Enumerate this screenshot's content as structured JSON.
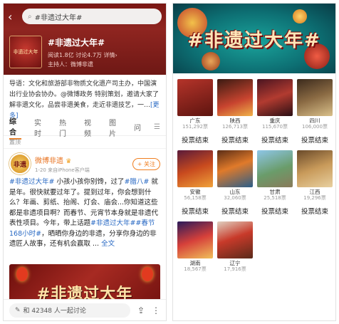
{
  "left": {
    "search_text": "#非遗过大年#",
    "topic": {
      "thumb_text": "非遗过大年",
      "title": "#非遗过大年#",
      "stats": "阅读1.8亿 讨论4.7万 详情›",
      "host": "主持人：微博非遗"
    },
    "guide": {
      "text": "导语：文化和旅游部非物质文化遗产司主办，中国演出行业协会协办。@微博政务 特别策划，邀请大家了解非遗文化，品尝非遗美食，走近非遗技艺，一…",
      "more": "[更多]"
    },
    "tabs": [
      "综合",
      "实时",
      "热门",
      "视频",
      "图片",
      "问"
    ],
    "pinned_label": "置顶",
    "post": {
      "avatar_text": "非遗",
      "author": "微博非遗",
      "time": "1-20 来自iPhone客户端",
      "follow": "+ 关注",
      "text_parts": [
        {
          "t": "#非遗过大年#",
          "tag": true
        },
        {
          "t": " 小孩小孩你别馋，过了",
          "tag": false
        },
        {
          "t": "#腊八#",
          "tag": true
        },
        {
          "t": " 就是年。很快就要过年了。提到过年，你会想到什么？年画、剪纸、抬阁、灯会、庙会...你知道这些都是非遗项目啊？而春节、元宵节本身就是非遗代表性项目。今年，带上话题",
          "tag": false
        },
        {
          "t": "#非遗过大年##春节168小时#",
          "tag": true
        },
        {
          "t": "，晒晒你身边的非遗，分享你身边的非遗匠人故事，还有机会赢取 ... ",
          "tag": false
        },
        {
          "t": "全文",
          "tag": true
        }
      ],
      "image_text": "#非遗过大年"
    },
    "discuss": "和 42348 人一起讨论"
  },
  "right": {
    "hero_title": "#非遗过大年#",
    "vote_label": "投票结束",
    "rows": [
      {
        "items": [
          {
            "name": "广东",
            "votes": "151,292票"
          },
          {
            "name": "陕西",
            "votes": "126,713票"
          },
          {
            "name": "重庆",
            "votes": "115,670票"
          },
          {
            "name": "四川",
            "votes": "106,000票"
          }
        ]
      },
      {
        "items": [
          {
            "name": "安徽",
            "votes": "56,158票"
          },
          {
            "name": "山东",
            "votes": "32,060票"
          },
          {
            "name": "甘肃",
            "votes": "25,518票"
          },
          {
            "name": "江西",
            "votes": "19,296票"
          }
        ]
      },
      {
        "items": [
          {
            "name": "湖南",
            "votes": "18,567票"
          },
          {
            "name": "辽宁",
            "votes": "17,916票"
          }
        ]
      }
    ]
  }
}
